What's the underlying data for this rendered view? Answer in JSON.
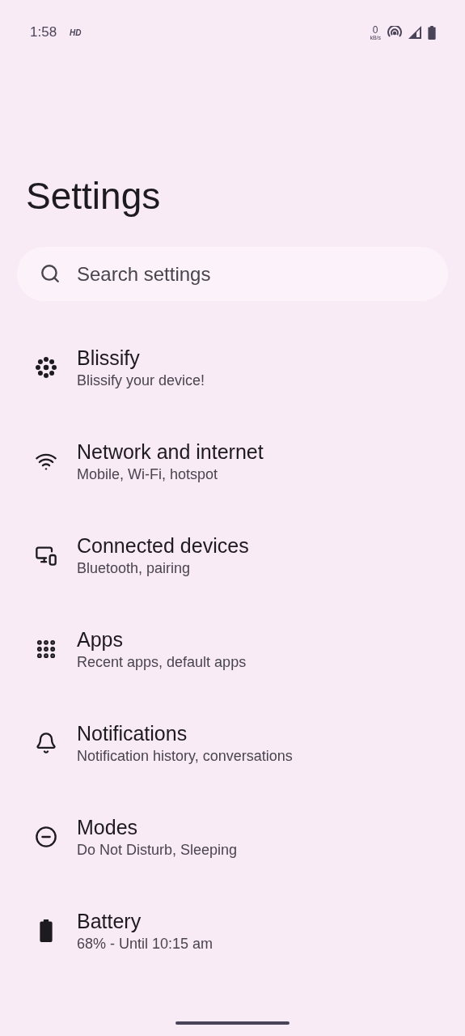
{
  "status_bar": {
    "time": "1:58",
    "hd": "HD",
    "speed": "0",
    "speed_unit": "kB/s"
  },
  "title": "Settings",
  "search": {
    "placeholder": "Search settings"
  },
  "items": [
    {
      "kind": "blissify",
      "title": "Blissify",
      "subtitle": "Blissify your device!"
    },
    {
      "kind": "wifi",
      "title": "Network and internet",
      "subtitle": "Mobile, Wi-Fi, hotspot"
    },
    {
      "kind": "devices",
      "title": "Connected devices",
      "subtitle": "Bluetooth, pairing"
    },
    {
      "kind": "apps",
      "title": "Apps",
      "subtitle": "Recent apps, default apps"
    },
    {
      "kind": "bell",
      "title": "Notifications",
      "subtitle": "Notification history, conversations"
    },
    {
      "kind": "modes",
      "title": "Modes",
      "subtitle": "Do Not Disturb, Sleeping"
    },
    {
      "kind": "battery",
      "title": "Battery",
      "subtitle": "68% - Until 10:15 am"
    }
  ]
}
